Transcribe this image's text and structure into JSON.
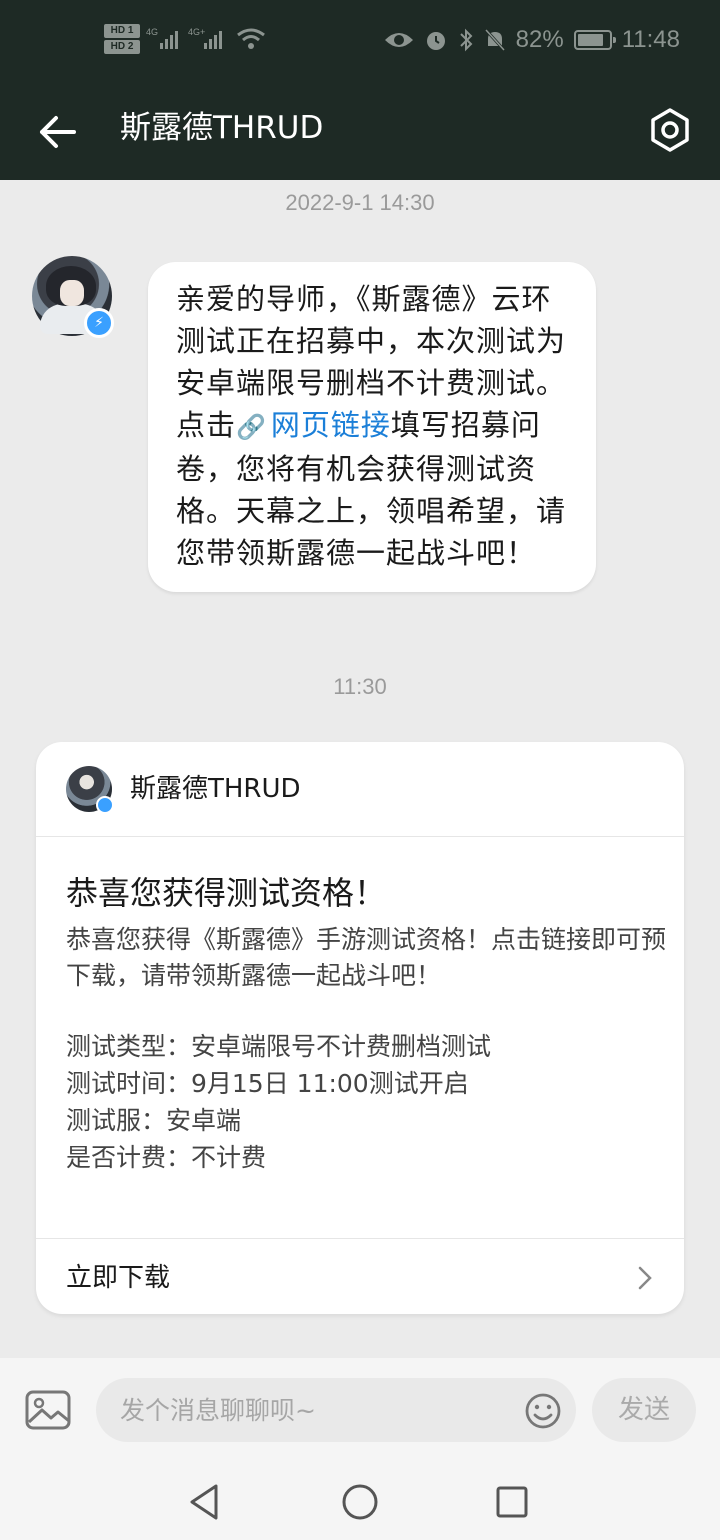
{
  "status_bar": {
    "hd1": "HD 1",
    "hd2": "HD 2",
    "signal1": "4G",
    "signal2": "4G+",
    "battery": "82%",
    "battery_level": 0.82,
    "time": "11:48"
  },
  "header": {
    "title": "斯露德THRUD",
    "back_icon": "arrow-left-icon",
    "settings_icon": "hexagon-settings-icon"
  },
  "messages": [
    {
      "timestamp": "2022-9-1 14:30",
      "text_before": "亲爱的导师，《斯露德》云环测试正在招募中，本次测试为安卓端限号删档不计费测试。点击",
      "link_icon": "link-icon",
      "link_text": "网页链接",
      "text_after": "填写招募问卷，您将有机会获得测试资格。天幕之上，领唱希望，请您带领斯露德一起战斗吧！"
    }
  ],
  "card": {
    "timestamp": "11:30",
    "sender": "斯露德THRUD",
    "title": "恭喜您获得测试资格！",
    "description": "恭喜您获得《斯露德》手游测试资格！点击链接即可预下载，请带领斯露德一起战斗吧！",
    "info_lines": [
      "测试类型：安卓端限号不计费删档测试",
      "测试时间：9月15日 11:00测试开启",
      "测试服：安卓端",
      "是否计费：不计费"
    ],
    "action_label": "立即下载"
  },
  "composer": {
    "placeholder": "发个消息聊聊呗~",
    "send_label": "发送"
  },
  "colors": {
    "header_bg": "#1e2a25",
    "page_bg": "#ebebeb",
    "link": "#1b7fd8",
    "badge": "#3aa0ff"
  }
}
